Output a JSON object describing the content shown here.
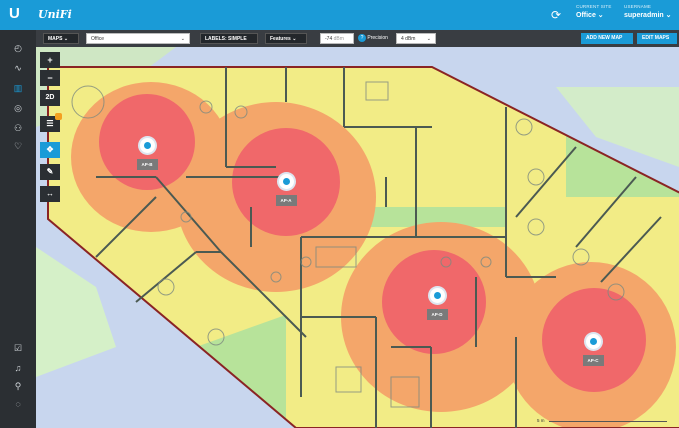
{
  "header": {
    "logo_glyph": "U",
    "logo_text": "UniFi",
    "current_site_label": "CURRENT SITE",
    "current_site_value": "Office",
    "username_label": "USERNAME",
    "username_value": "superadmin"
  },
  "toolbar": {
    "maps_label": "MAPS",
    "map_select_value": "Office",
    "labels_label": "LABELS: SIMPLE",
    "features_label": "Features",
    "signal_value": "-74",
    "signal_unit": "dBm",
    "precision_label": "Precision",
    "precision_value": "4 dBm",
    "add_new_map": "ADD NEW MAP",
    "edit_maps": "EDIT MAPS"
  },
  "map_controls": {
    "zoom_in": "+",
    "zoom_out": "−",
    "mode_2d": "2D"
  },
  "access_points": [
    {
      "label": "AP-B"
    },
    {
      "label": "AP-A"
    },
    {
      "label": "AP-D"
    },
    {
      "label": "AP-C"
    }
  ],
  "scale_label": "5 m",
  "colors": {
    "topbar": "#1a9bd7",
    "sidebar": "#2b2f33",
    "toolbar": "#393d42",
    "strong_signal": "#f0686a",
    "good_signal": "#f4a66a",
    "medium_signal": "#f2ec86",
    "weak_signal": "#b7e39a",
    "wall": "#8a2424"
  },
  "sidebar_icons": [
    "dashboard-icon",
    "statistics-icon",
    "map-icon",
    "devices-icon",
    "clients-icon",
    "insights-icon",
    "events-icon",
    "alerts-icon",
    "user-search-icon",
    "chat-icon"
  ]
}
